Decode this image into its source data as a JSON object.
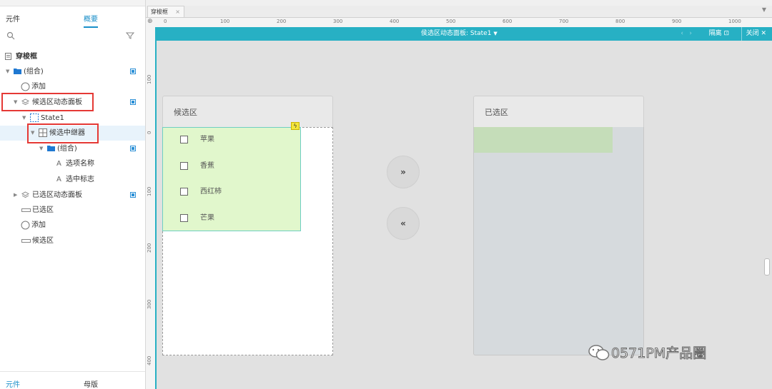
{
  "left_panel": {
    "tabs": [
      {
        "label": "元件"
      },
      {
        "label": "概要"
      }
    ],
    "bottom_tabs": [
      {
        "label": "元件"
      },
      {
        "label": "母版"
      }
    ],
    "tree": [
      {
        "label": "穿梭框"
      },
      {
        "label": "(组合)"
      },
      {
        "label": "添加"
      },
      {
        "label": "候选区动态面板"
      },
      {
        "label": "State1"
      },
      {
        "label": "候选中继器"
      },
      {
        "label": "(组合)"
      },
      {
        "label": "选项名称"
      },
      {
        "label": "选中标志"
      },
      {
        "label": "已选区动态面板"
      },
      {
        "label": "已选区"
      },
      {
        "label": "添加"
      },
      {
        "label": "候选区"
      }
    ]
  },
  "editor": {
    "doc_tab": "穿梭框",
    "ruler_h": [
      "0",
      "100",
      "200",
      "300",
      "400",
      "500",
      "600",
      "700",
      "800",
      "900",
      "1000"
    ],
    "ruler_v": [
      "100",
      "0",
      "100",
      "200",
      "300",
      "400"
    ],
    "panel_bar": {
      "title": "侯选区动态面板: State1",
      "isolate": "隔离",
      "close": "关闭"
    },
    "candidate": {
      "title": "候选区",
      "items": [
        "苹果",
        "香蕉",
        "西红柿",
        "芒果"
      ]
    },
    "selected": {
      "title": "已选区"
    },
    "buttons": {
      "forward": "»",
      "back": "«"
    },
    "watermark": "0571PM产品圈"
  },
  "colors": {
    "accent": "#1a8fc9",
    "panel_bar": "#27b0c4",
    "highlight_red": "#e53935",
    "repeater_fill": "#e1f7cc",
    "selected_row": "#c5ddb9"
  }
}
